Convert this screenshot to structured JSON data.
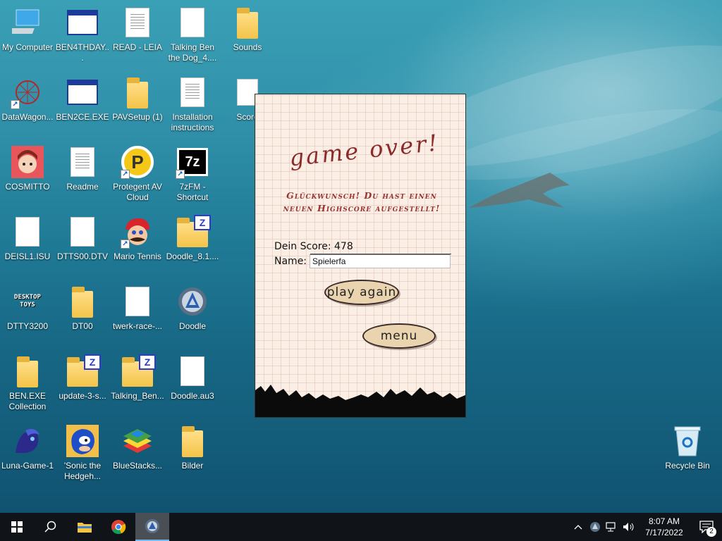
{
  "desktop": {
    "icons": [
      {
        "label": "My Computer"
      },
      {
        "label": "BEN4THDAY..."
      },
      {
        "label": "READ - LEIA"
      },
      {
        "label": "Talking Ben the Dog_4...."
      },
      {
        "label": "Sounds"
      },
      {
        "label": "DataWagon..."
      },
      {
        "label": "BEN2CE.EXE"
      },
      {
        "label": "PAVSetup (1)"
      },
      {
        "label": "Installation instructions"
      },
      {
        "label": "Score"
      },
      {
        "label": "COSMITTO"
      },
      {
        "label": "Readme"
      },
      {
        "label": "Protegent AV Cloud"
      },
      {
        "label": "7zFM - Shortcut"
      },
      {
        "label": "DEISL1.ISU"
      },
      {
        "label": "DTTS00.DTV"
      },
      {
        "label": "Mario Tennis"
      },
      {
        "label": "Doodle_8.1...."
      },
      {
        "label": "DTTY3200"
      },
      {
        "label": "DT00"
      },
      {
        "label": "twerk-race-..."
      },
      {
        "label": "Doodle"
      },
      {
        "label": "BEN.EXE Collection"
      },
      {
        "label": "update-3-s..."
      },
      {
        "label": "Talking_Ben..."
      },
      {
        "label": "Doodle.au3"
      },
      {
        "label": "Luna-Game-1"
      },
      {
        "label": "'Sonic the Hedgeh..."
      },
      {
        "label": "BlueStacks..."
      },
      {
        "label": "Bilder"
      },
      {
        "label": "Recycle Bin"
      }
    ],
    "icon_text": {
      "seven_z": "7z",
      "desktop_toys": "DESKTOP TOYS",
      "protegent_letter": "P",
      "zip_badge": "Z"
    }
  },
  "game": {
    "title": "game over!",
    "congrats_line1": "Glückwunsch! Du hast einen",
    "congrats_line2": "neuen Highscore aufgestellt!",
    "score_label": "Dein Score:",
    "score_value": "478",
    "name_label": "Name:",
    "name_value": "Spielerfa",
    "play_again_label": "play again",
    "menu_label": "menu"
  },
  "taskbar": {
    "time": "8:07 AM",
    "date": "7/17/2022",
    "notification_count": "2",
    "accent": "#76b9ed"
  }
}
